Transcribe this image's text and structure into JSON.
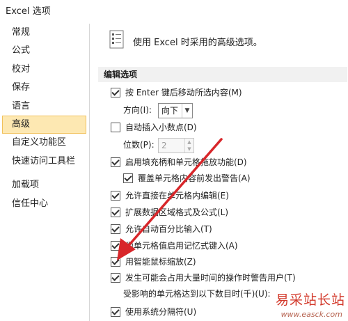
{
  "window": {
    "title": "Excel 选项"
  },
  "sidebar": {
    "items": [
      {
        "label": "常规"
      },
      {
        "label": "公式"
      },
      {
        "label": "校对"
      },
      {
        "label": "保存"
      },
      {
        "label": "语言"
      },
      {
        "label": "高级",
        "active": true
      },
      {
        "label": "自定义功能区"
      },
      {
        "label": "快速访问工具栏"
      },
      {
        "label": "加载项"
      },
      {
        "label": "信任中心"
      }
    ]
  },
  "header": {
    "text": "使用 Excel 时采用的高级选项。"
  },
  "section": {
    "title": "编辑选项"
  },
  "options": {
    "move_after_enter": {
      "label": "按 Enter 键后移动所选内容(M)",
      "checked": true
    },
    "direction": {
      "label": "方向(I):",
      "value": "向下"
    },
    "auto_decimal": {
      "label": "自动插入小数点(D)",
      "checked": false
    },
    "places": {
      "label": "位数(P):",
      "value": "2"
    },
    "fill_handle": {
      "label": "启用填充柄和单元格拖放功能(D)",
      "checked": true
    },
    "alert_overwrite": {
      "label": "覆盖单元格内容前发出警告(A)",
      "checked": true
    },
    "edit_in_cell": {
      "label": "允许直接在单元格内编辑(E)",
      "checked": true
    },
    "extend_formats": {
      "label": "扩展数据区域格式及公式(L)",
      "checked": true
    },
    "auto_percent": {
      "label": "允许自动百分比输入(T)",
      "checked": true
    },
    "autocomplete": {
      "label": "为单元格值启用记忆式键入(A)",
      "checked": true
    },
    "intellimouse": {
      "label": "用智能鼠标缩放(Z)",
      "checked": true
    },
    "alert_slow": {
      "label": "发生可能会占用大量时间的操作时警告用户(T)",
      "checked": true
    },
    "affected_cells": {
      "label": "受影响的单元格达到以下数目时(千)(U):"
    },
    "system_separators": {
      "label": "使用系统分隔符(U)",
      "checked": true
    }
  },
  "watermark": {
    "text": "易采站长站",
    "url": "www.easck.com"
  },
  "colors": {
    "accent": "#d8262a",
    "active_bg": "#fde8b2",
    "active_border": "#f1c15b"
  }
}
